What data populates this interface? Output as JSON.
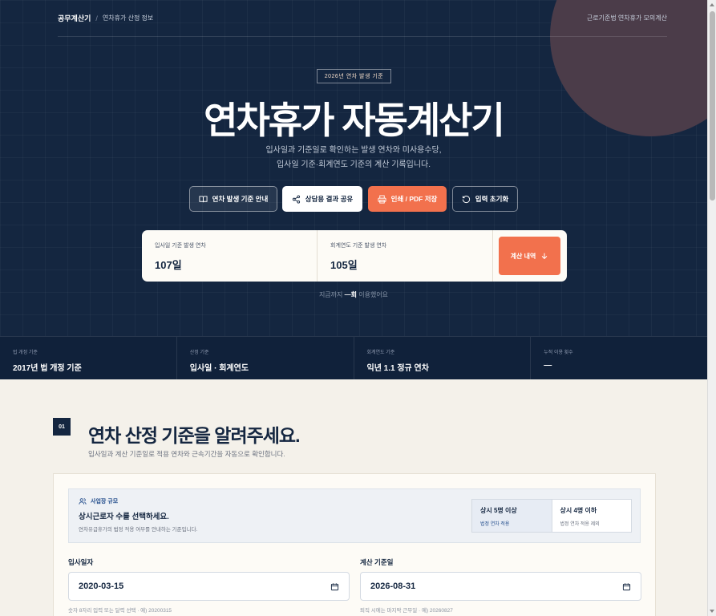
{
  "nav": {
    "brand": "공무계산기",
    "separator": "/",
    "breadcrumb": "연차휴가 산정 정보",
    "right_link": "근로기준법 연차휴가 모의계산"
  },
  "hero": {
    "badge": "2026년 연차 발생 기준",
    "title": "연차휴가 자동계산기",
    "subtitle_line1": "입사일과 기준일로 확인하는 발생 연차와 미사용수당,",
    "subtitle_line2": "입사일 기준·회계연도 기준의 계산 기록입니다."
  },
  "actions": {
    "guide": "연차 발생 기준 안내",
    "share": "상담용 결과 공유",
    "print": "인쇄 / PDF 저장",
    "reset": "입력 초기화"
  },
  "result": {
    "hire_label": "입사일 기준 발생 연차",
    "hire_value": "107일",
    "fiscal_label": "회계연도 기준 발생 연차",
    "fiscal_value": "105일",
    "detail_button": "계산 내역"
  },
  "usage": {
    "prefix": "지금까지",
    "count": "—회",
    "suffix": "이용했어요"
  },
  "stats": [
    {
      "label": "법 개정 기준",
      "value": "2017년 법 개정 기준"
    },
    {
      "label": "산정 기준",
      "value": "입사일 · 회계연도"
    },
    {
      "label": "회계연도 기준",
      "value": "익년 1.1 정규 연차"
    },
    {
      "label": "누적 이용 횟수",
      "value": "—"
    }
  ],
  "section": {
    "step": "01",
    "title": "연차 산정 기준을 알려주세요.",
    "subtitle": "입사일과 계산 기준일로 적용 연차와 근속기간을 자동으로 확인합니다."
  },
  "workplace": {
    "heading": "사업장 규모",
    "question": "상시근로자 수를 선택하세요.",
    "note": "연차유급휴가의 법정 적용 여부를 안내하는 기준입니다.",
    "options": [
      {
        "title": "상시 5명 이상",
        "desc": "법정 연차 적용"
      },
      {
        "title": "상시 4명 이하",
        "desc": "법정 연차 적용 제외"
      }
    ]
  },
  "fields": {
    "hire_label": "입사일자",
    "hire_value": "2020-03-15",
    "hire_help": "숫자 8자리 입력 또는 달력 선택 · 예) 20200315",
    "calc_label": "계산 기준일",
    "calc_value": "2026-08-31",
    "calc_help": "퇴직 시에는 마지막 근무일 · 예) 20260827"
  },
  "colors": {
    "navy": "#142640",
    "accent": "#f2714d",
    "cream": "#f4f1ea"
  }
}
